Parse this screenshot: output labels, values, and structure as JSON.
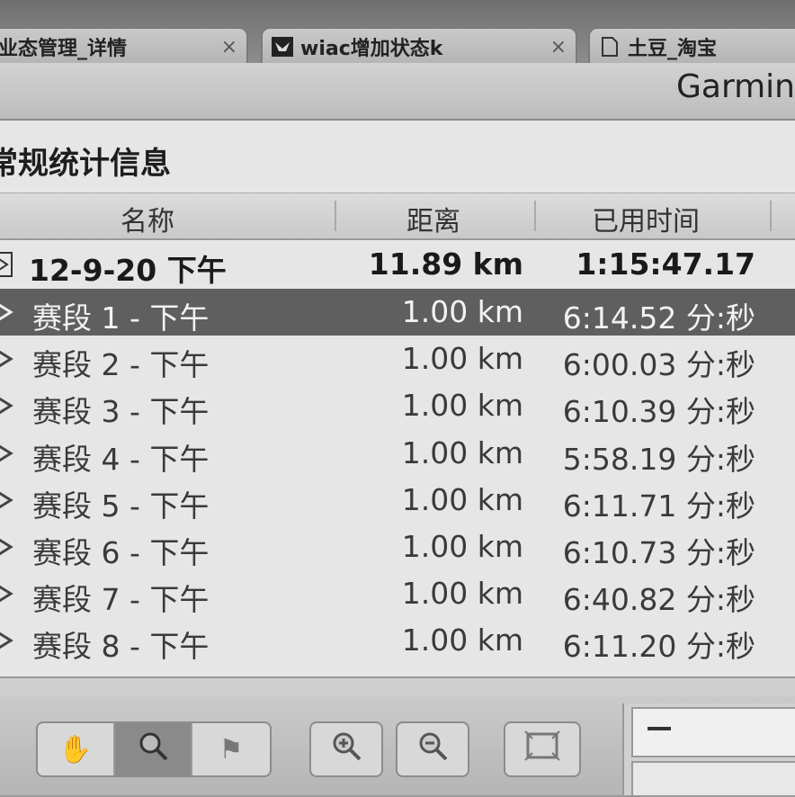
{
  "tabs": [
    {
      "label": "业态管理_详情",
      "icon": "document-icon"
    },
    {
      "label": "wiac增加状态k",
      "icon": "bird-icon"
    },
    {
      "label": "土豆_淘宝",
      "icon": "document-icon"
    }
  ],
  "tab_close": "×",
  "window": {
    "title": "Garmin"
  },
  "section_title": "常规统计信息",
  "columns": {
    "name": "名称",
    "distance": "距离",
    "elapsed": "已用时间"
  },
  "summary": {
    "name": "12-9-20 下午",
    "distance": "11.89 km",
    "elapsed": "1:15:47.17"
  },
  "laps": [
    {
      "name": "赛段 1 - 下午",
      "distance": "1.00 km",
      "pace": "6:14.52 分:秒"
    },
    {
      "name": "赛段 2 - 下午",
      "distance": "1.00 km",
      "pace": "6:00.03 分:秒"
    },
    {
      "name": "赛段 3 - 下午",
      "distance": "1.00 km",
      "pace": "6:10.39 分:秒"
    },
    {
      "name": "赛段 4 - 下午",
      "distance": "1.00 km",
      "pace": "5:58.19 分:秒"
    },
    {
      "name": "赛段 5 - 下午",
      "distance": "1.00 km",
      "pace": "6:11.71 分:秒"
    },
    {
      "name": "赛段 6 - 下午",
      "distance": "1.00 km",
      "pace": "6:10.73 分:秒"
    },
    {
      "name": "赛段 7 - 下午",
      "distance": "1.00 km",
      "pace": "6:40.82 分:秒"
    },
    {
      "name": "赛段 8 - 下午",
      "distance": "1.00 km",
      "pace": "6:11.20 分:秒"
    }
  ],
  "selected_lap_index": 0,
  "toolbar": {
    "pan_icon": "hand-icon",
    "select_icon": "magnifier-icon",
    "flag_icon": "flag-icon",
    "zoom_in_icon": "zoom-in-icon",
    "zoom_out_icon": "zoom-out-icon",
    "fit_icon": "fit-to-window-icon"
  },
  "colors": {
    "selected_row": "#5f5f5f",
    "panel_bg": "#e6e6e6"
  }
}
